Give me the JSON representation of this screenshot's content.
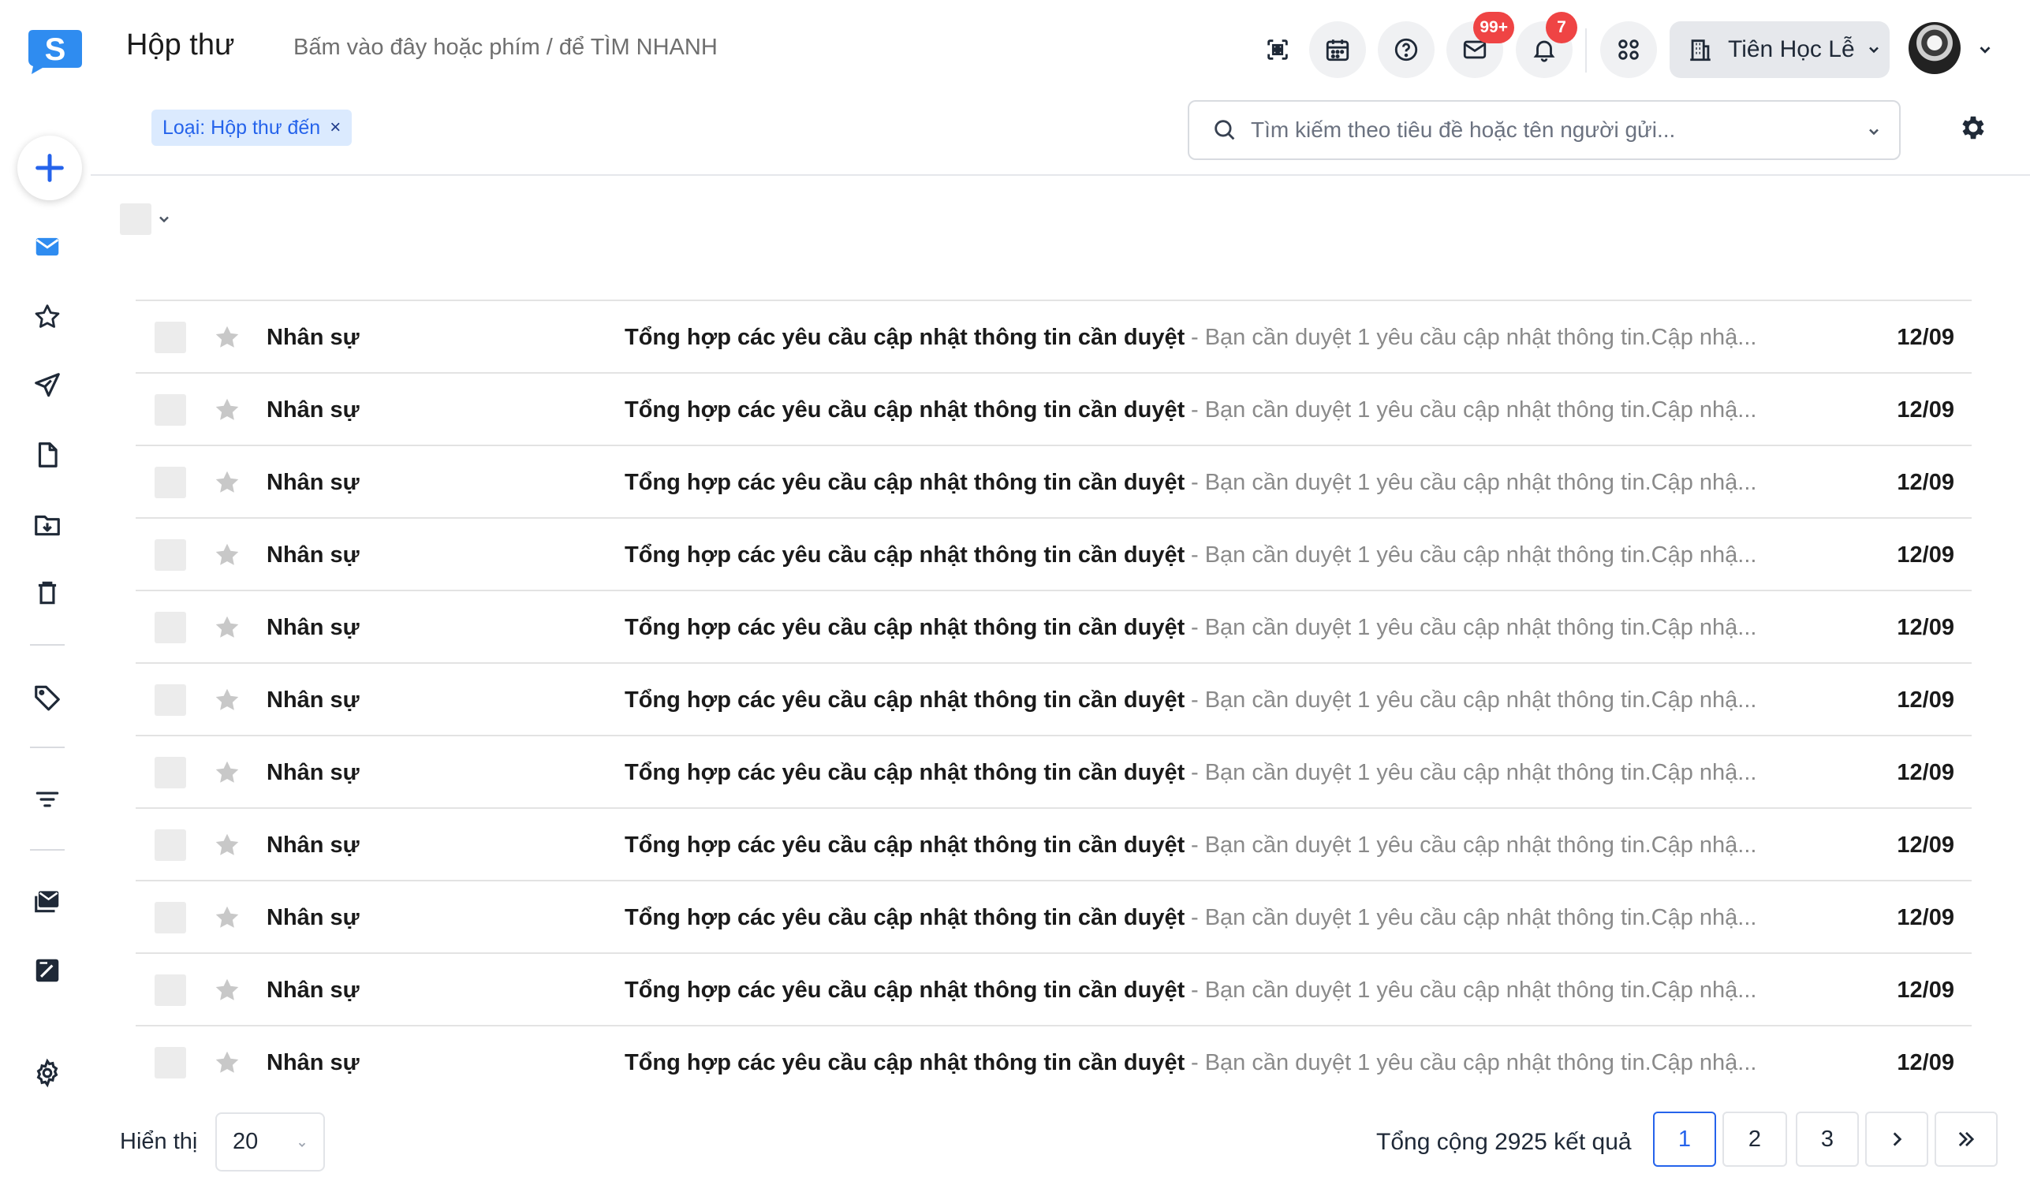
{
  "header": {
    "app_title": "Hộp thư",
    "quick_search_hint": "Bấm vào đây hoặc phím / để TÌM NHANH",
    "mail_badge": "99+",
    "notification_badge": "7",
    "org_name": "Tiên Học Lễ"
  },
  "icons": {
    "logo": "s-logo-icon",
    "header": [
      "qr-code-icon",
      "calendar-icon",
      "help-icon",
      "mail-icon",
      "bell-icon",
      "apps-icon",
      "building-icon",
      "chevron-down-icon"
    ],
    "sidebar": [
      "plus-icon",
      "inbox-icon",
      "star-icon",
      "send-icon",
      "draft-icon",
      "archive-icon",
      "trash-icon",
      "tag-icon",
      "filter-icon",
      "mail-stack-icon",
      "notes-icon",
      "gear-icon"
    ]
  },
  "filter": {
    "chip_label": "Loại: Hộp thư đến",
    "chip_close": "×",
    "search_placeholder": "Tìm kiếm theo tiêu đề hoặc tên người gửi..."
  },
  "colors": {
    "accent": "#2563eb",
    "badge": "#ef4444",
    "chip_bg": "#dbeafe"
  },
  "messages": [
    {
      "sender": "Nhân sự",
      "subject": "Tổng hợp các yêu cầu cập nhật thông tin cần duyệt",
      "snippet": "- Bạn cần duyệt 1 yêu cầu cập nhật thông tin.Cập nhậ...",
      "date": "12/09"
    },
    {
      "sender": "Nhân sự",
      "subject": "Tổng hợp các yêu cầu cập nhật thông tin cần duyệt",
      "snippet": "- Bạn cần duyệt 1 yêu cầu cập nhật thông tin.Cập nhậ...",
      "date": "12/09"
    },
    {
      "sender": "Nhân sự",
      "subject": "Tổng hợp các yêu cầu cập nhật thông tin cần duyệt",
      "snippet": "- Bạn cần duyệt 1 yêu cầu cập nhật thông tin.Cập nhậ...",
      "date": "12/09"
    },
    {
      "sender": "Nhân sự",
      "subject": "Tổng hợp các yêu cầu cập nhật thông tin cần duyệt",
      "snippet": "- Bạn cần duyệt 1 yêu cầu cập nhật thông tin.Cập nhậ...",
      "date": "12/09"
    },
    {
      "sender": "Nhân sự",
      "subject": "Tổng hợp các yêu cầu cập nhật thông tin cần duyệt",
      "snippet": "- Bạn cần duyệt 1 yêu cầu cập nhật thông tin.Cập nhậ...",
      "date": "12/09"
    },
    {
      "sender": "Nhân sự",
      "subject": "Tổng hợp các yêu cầu cập nhật thông tin cần duyệt",
      "snippet": "- Bạn cần duyệt 1 yêu cầu cập nhật thông tin.Cập nhậ...",
      "date": "12/09"
    },
    {
      "sender": "Nhân sự",
      "subject": "Tổng hợp các yêu cầu cập nhật thông tin cần duyệt",
      "snippet": "- Bạn cần duyệt 1 yêu cầu cập nhật thông tin.Cập nhậ...",
      "date": "12/09"
    },
    {
      "sender": "Nhân sự",
      "subject": "Tổng hợp các yêu cầu cập nhật thông tin cần duyệt",
      "snippet": "- Bạn cần duyệt 1 yêu cầu cập nhật thông tin.Cập nhậ...",
      "date": "12/09"
    },
    {
      "sender": "Nhân sự",
      "subject": "Tổng hợp các yêu cầu cập nhật thông tin cần duyệt",
      "snippet": "- Bạn cần duyệt 1 yêu cầu cập nhật thông tin.Cập nhậ...",
      "date": "12/09"
    },
    {
      "sender": "Nhân sự",
      "subject": "Tổng hợp các yêu cầu cập nhật thông tin cần duyệt",
      "snippet": "- Bạn cần duyệt 1 yêu cầu cập nhật thông tin.Cập nhậ...",
      "date": "12/09"
    },
    {
      "sender": "Nhân sự",
      "subject": "Tổng hợp các yêu cầu cập nhật thông tin cần duyệt",
      "snippet": "- Bạn cần duyệt 1 yêu cầu cập nhật thông tin.Cập nhậ...",
      "date": "12/09"
    }
  ],
  "footer": {
    "show_label": "Hiển thị",
    "page_size": "20",
    "total_text": "Tổng cộng 2925 kết quả",
    "pages": [
      "1",
      "2",
      "3"
    ],
    "current_page": "1"
  }
}
